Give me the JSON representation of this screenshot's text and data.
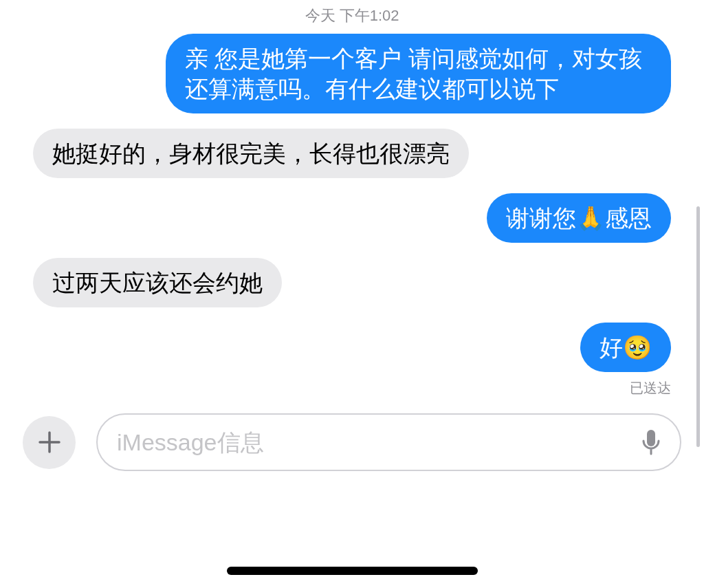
{
  "timestamp": "今天 下午1:02",
  "messages": [
    {
      "kind": "sent",
      "text": "亲 您是她第一个客户 请问感觉如何，对女孩还算满意吗。有什么建议都可以说下"
    },
    {
      "kind": "received",
      "text": "她挺好的，身材很完美，长得也很漂亮"
    },
    {
      "kind": "sent",
      "text": "谢谢您🙏感恩"
    },
    {
      "kind": "received",
      "text": "过两天应该还会约她"
    },
    {
      "kind": "sent",
      "text": "好🥹"
    }
  ],
  "delivery_status": "已送达",
  "composer": {
    "placeholder": "iMessage信息"
  }
}
